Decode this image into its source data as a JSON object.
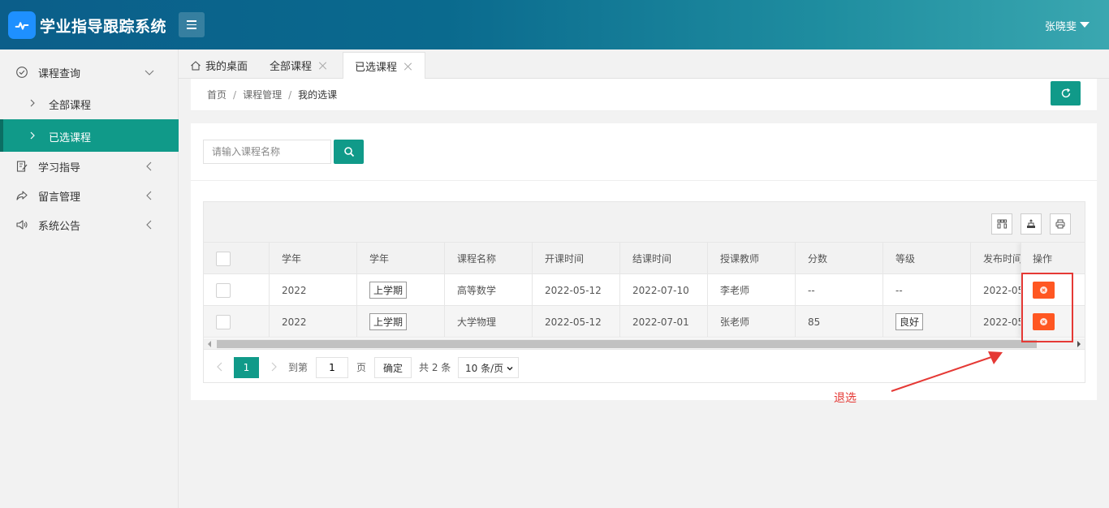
{
  "app": {
    "title": "学业指导跟踪系统",
    "user": "张晓斐"
  },
  "sidebar": {
    "items": [
      {
        "label": "课程查询"
      },
      {
        "label": "全部课程"
      },
      {
        "label": "已选课程"
      },
      {
        "label": "学习指导"
      },
      {
        "label": "留言管理"
      },
      {
        "label": "系统公告"
      }
    ]
  },
  "tabs": [
    {
      "label": "我的桌面"
    },
    {
      "label": "全部课程"
    },
    {
      "label": "已选课程"
    }
  ],
  "breadcrumb": {
    "home": "首页",
    "sep": "/",
    "section": "课程管理",
    "current": "我的选课"
  },
  "search": {
    "placeholder": "请输入课程名称"
  },
  "table": {
    "headers": [
      "学年",
      "学年",
      "课程名称",
      "开课时间",
      "结课时间",
      "授课教师",
      "分数",
      "等级",
      "发布时间",
      "操作"
    ],
    "rows": [
      {
        "year": "2022",
        "term": "上学期",
        "course": "高等数学",
        "start": "2022-05-12",
        "end": "2022-07-10",
        "teacher": "李老师",
        "score": "--",
        "grade": "--",
        "publish": "2022-05-"
      },
      {
        "year": "2022",
        "term": "上学期",
        "course": "大学物理",
        "start": "2022-05-12",
        "end": "2022-07-01",
        "teacher": "张老师",
        "score": "85",
        "grade": "良好",
        "publish": "2022-05-"
      }
    ]
  },
  "pager": {
    "current": "1",
    "goto_label": "到第",
    "page_value": "1",
    "page_label": "页",
    "confirm": "确定",
    "total": "共 2 条",
    "page_size": "10 条/页"
  },
  "annotation": {
    "label": "退选"
  },
  "colors": {
    "accent": "#109a89",
    "danger": "#ff5722",
    "annotation": "#e53935"
  }
}
